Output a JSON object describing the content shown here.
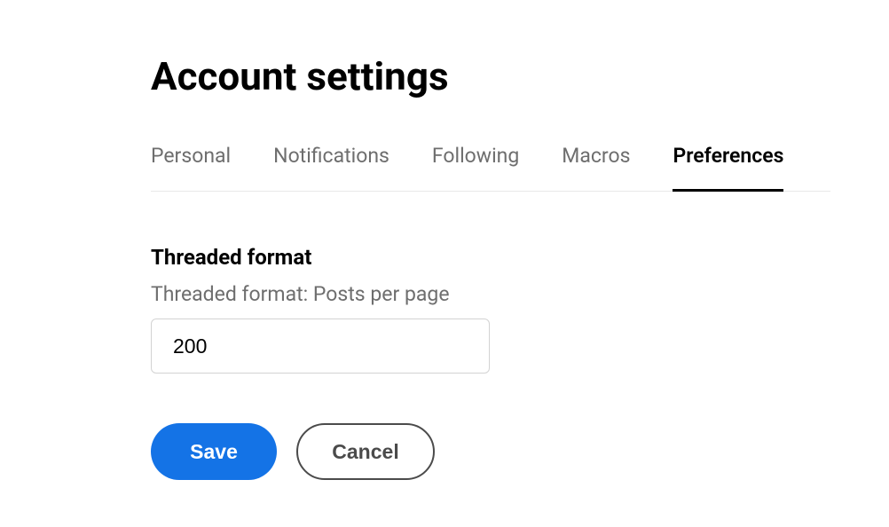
{
  "page": {
    "title": "Account settings"
  },
  "tabs": {
    "items": [
      {
        "label": "Personal",
        "active": false
      },
      {
        "label": "Notifications",
        "active": false
      },
      {
        "label": "Following",
        "active": false
      },
      {
        "label": "Macros",
        "active": false
      },
      {
        "label": "Preferences",
        "active": true
      }
    ]
  },
  "section": {
    "heading": "Threaded format",
    "field_label": "Threaded format: Posts per page",
    "field_value": "200"
  },
  "buttons": {
    "save": "Save",
    "cancel": "Cancel"
  }
}
